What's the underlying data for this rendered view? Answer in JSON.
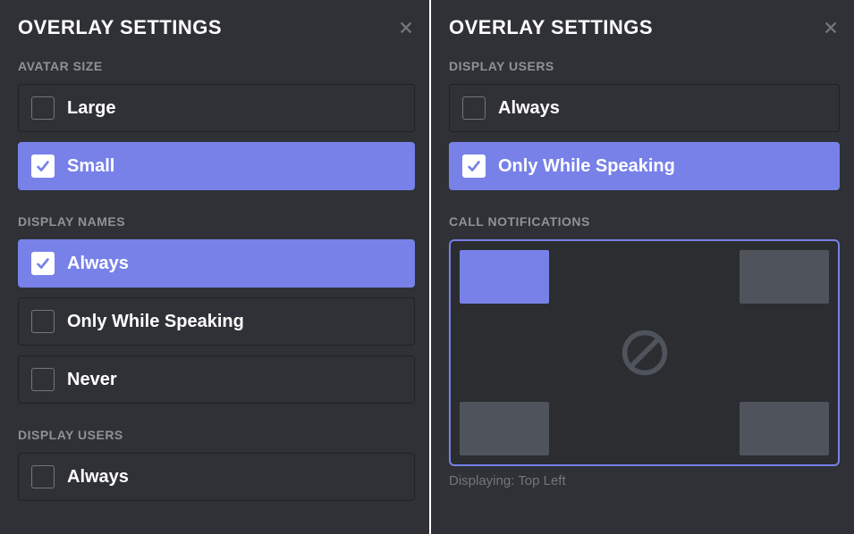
{
  "left": {
    "title": "OVERLAY SETTINGS",
    "sections": {
      "avatar_size": {
        "label": "AVATAR SIZE",
        "options": {
          "large": "Large",
          "small": "Small"
        }
      },
      "display_names": {
        "label": "DISPLAY NAMES",
        "options": {
          "always": "Always",
          "speaking": "Only While Speaking",
          "never": "Never"
        }
      },
      "display_users": {
        "label": "DISPLAY USERS",
        "options": {
          "always": "Always"
        }
      }
    }
  },
  "right": {
    "title": "OVERLAY SETTINGS",
    "sections": {
      "display_users": {
        "label": "DISPLAY USERS",
        "options": {
          "always": "Always",
          "speaking": "Only While Speaking"
        }
      },
      "call_notifications": {
        "label": "CALL NOTIFICATIONS",
        "caption": "Displaying: Top Left",
        "selected": "top-left"
      }
    }
  }
}
